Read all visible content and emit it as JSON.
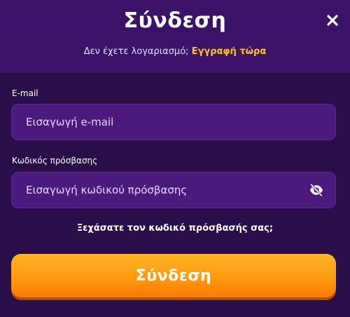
{
  "modal": {
    "title": "Σύνδεση",
    "subtitle_text": "Δεν έχετε λογαριασμό;",
    "subtitle_link": "Εγγραφή τώρα"
  },
  "form": {
    "email_label": "E-mail",
    "email_placeholder": "Εισαγωγή e-mail",
    "email_value": "",
    "password_label": "Κωδικός πρόσβασης",
    "password_placeholder": "Εισαγωγή κωδικού πρόσβασης",
    "password_value": "",
    "forgot_label": "Ξεχάσατε τον κωδικό πρόσβασής σας;",
    "submit_label": "Σύνδεση"
  },
  "icons": {
    "close": "close-icon",
    "password_toggle": "eye-slash-icon"
  },
  "colors": {
    "background": "#2a0e49",
    "header": "#3a1268",
    "input": "#4a1a7d",
    "accent_link": "#ffc21f",
    "button_top": "#ffb526",
    "button_bottom": "#f97a05"
  }
}
